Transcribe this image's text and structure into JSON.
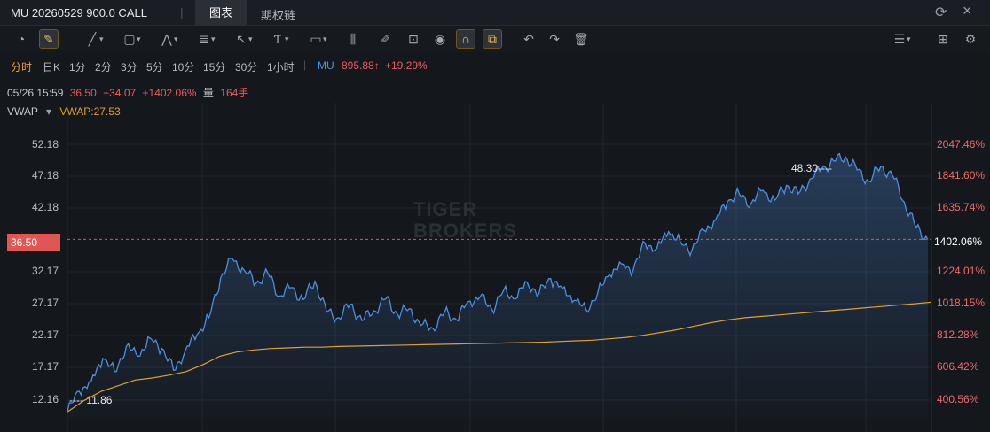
{
  "window": {
    "title": "MU 20260529 900.0 CALL",
    "tabs": [
      "图表",
      "期权链"
    ]
  },
  "periods": {
    "items": [
      "分时",
      "日K",
      "1分",
      "2分",
      "3分",
      "5分",
      "10分",
      "15分",
      "30分",
      "1小时"
    ],
    "active": "分时"
  },
  "symbol": {
    "name": "MU",
    "price": "895.88↑",
    "change": "+19.29%"
  },
  "info": {
    "datetime": "05/26 15:59",
    "price": "36.50",
    "change": "+34.07",
    "pct": "+1402.06%",
    "vol_label": "量",
    "volume": "164手"
  },
  "indicator": {
    "name": "VWAP",
    "dropdown": "▾",
    "value_text": "VWAP:27.53"
  },
  "y_labels_left": [
    "52.18",
    "47.18",
    "42.18",
    "32.17",
    "27.17",
    "22.17",
    "17.17",
    "12.16"
  ],
  "y_labels_right": [
    "2047.46%",
    "1841.60%",
    "1635.74%",
    "1224.01%",
    "1018.15%",
    "812.28%",
    "606.42%",
    "400.56%"
  ],
  "current": {
    "left": "36.50",
    "right": "1402.06%"
  },
  "high_label": "48.30----",
  "low_label": "---- 11.86",
  "watermark": [
    "TIGER",
    "BROKERS"
  ],
  "colors": {
    "price_line": "#4d8fe0",
    "vwap_line": "#e0a030",
    "up": "#ef5a5a",
    "accent": "#e4c14c"
  },
  "chart_data": {
    "type": "line",
    "ylim": [
      10.5,
      54.5
    ],
    "series": [
      {
        "name": "MU",
        "values": [
          11.86,
          14.8,
          16.2,
          19.5,
          17.6,
          21.2,
          19.8,
          22.4,
          20.9,
          17.8,
          20.6,
          22.9,
          25.3,
          31.0,
          33.7,
          32.1,
          30.2,
          31.7,
          28.4,
          29.6,
          27.9,
          30.5,
          26.1,
          25.3,
          27.2,
          24.9,
          26.3,
          28.0,
          25.8,
          26.6,
          24.2,
          23.8,
          26.1,
          25.0,
          27.6,
          28.3,
          26.5,
          29.2,
          28.0,
          30.4,
          28.7,
          30.9,
          29.5,
          27.8,
          26.4,
          28.9,
          31.5,
          33.0,
          32.1,
          36.0,
          35.2,
          37.6,
          36.1,
          35.0,
          37.8,
          39.3,
          41.9,
          43.0,
          41.6,
          43.5,
          42.1,
          44.2,
          43.0,
          45.1,
          46.6,
          47.7,
          48.3,
          46.4,
          44.8,
          46.9,
          45.6,
          41.8,
          38.2,
          36.5
        ]
      },
      {
        "name": "VWAP",
        "values": [
          11.86,
          13.5,
          14.8,
          15.6,
          16.4,
          16.7,
          17.1,
          17.6,
          18.6,
          19.8,
          20.4,
          20.7,
          20.9,
          21.0,
          21.1,
          21.1,
          21.2,
          21.25,
          21.3,
          21.35,
          21.4,
          21.45,
          21.5,
          21.55,
          21.6,
          21.65,
          21.7,
          21.75,
          21.8,
          21.9,
          22.0,
          22.1,
          22.3,
          22.5,
          22.8,
          23.2,
          23.6,
          24.1,
          24.6,
          25.0,
          25.3,
          25.5,
          25.7,
          25.9,
          26.1,
          26.3,
          26.5,
          26.7,
          26.9,
          27.1,
          27.3,
          27.53
        ]
      }
    ]
  }
}
